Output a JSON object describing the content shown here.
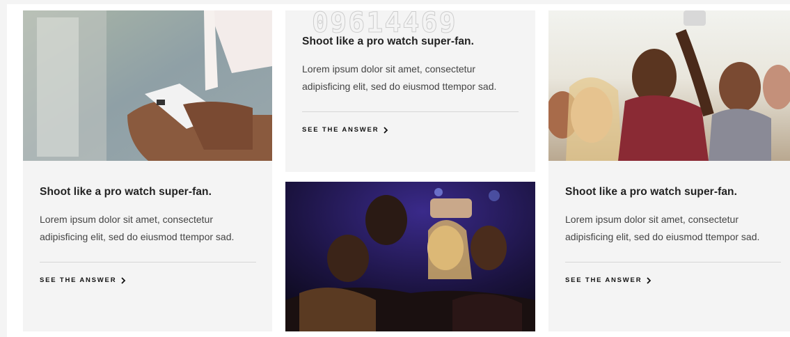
{
  "cards": [
    {
      "title": "Shoot like a pro watch super-fan.",
      "description": "Lorem ipsum dolor sit amet, consectetur adipisficing elit, sed do eiusmod ttempor sad.",
      "cta": "SEE THE ANSWER"
    },
    {
      "title": "Shoot like a pro watch super-fan.",
      "description": "Lorem ipsum dolor sit amet, consectetur adipisficing elit, sed do eiusmod ttempor sad.",
      "cta": "SEE THE ANSWER"
    },
    {
      "title": "Shoot like a pro watch super-fan.",
      "description": "Lorem ipsum dolor sit amet, consectetur adipisficing elit, sed do eiusmod ttempor sad.",
      "cta": "SEE THE ANSWER"
    }
  ],
  "images": {
    "phone_in_hands": "phone-in-hands-photo",
    "party_selfie": "party-selfie-photo",
    "festival_selfie": "festival-selfie-photo"
  },
  "watermark": "09614469",
  "colors": {
    "card_bg": "#f4f4f4",
    "divider": "#d6d6d6",
    "text": "#222222"
  }
}
